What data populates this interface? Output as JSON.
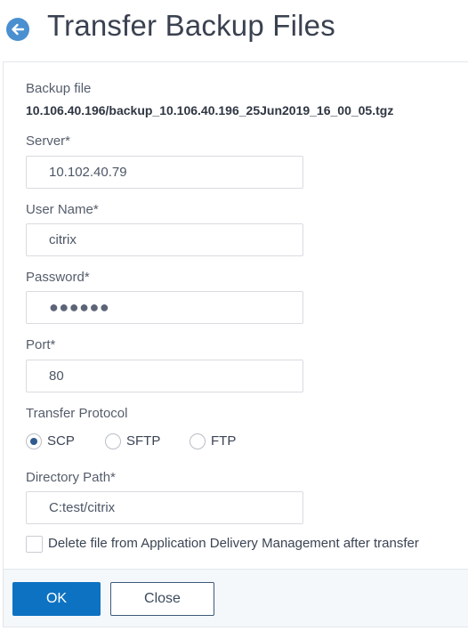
{
  "header": {
    "title": "Transfer Backup Files",
    "back_icon": "arrow-left-circle-icon"
  },
  "form": {
    "backup_file": {
      "label": "Backup file",
      "value": "10.106.40.196/backup_10.106.40.196_25Jun2019_16_00_05.tgz"
    },
    "server": {
      "label": "Server*",
      "value": "10.102.40.79"
    },
    "user_name": {
      "label": "User Name*",
      "value": "citrix"
    },
    "password": {
      "label": "Password*",
      "value": "●●●●●●"
    },
    "port": {
      "label": "Port*",
      "value": "80"
    },
    "transfer_protocol": {
      "label": "Transfer Protocol",
      "options": [
        {
          "label": "SCP",
          "selected": true
        },
        {
          "label": "SFTP",
          "selected": false
        },
        {
          "label": "FTP",
          "selected": false
        }
      ]
    },
    "directory_path": {
      "label": "Directory Path*",
      "value": "C:test/citrix"
    },
    "delete_after_transfer": {
      "label": "Delete file from Application Delivery Management after transfer",
      "checked": false
    }
  },
  "footer": {
    "ok_label": "OK",
    "close_label": "Close"
  },
  "colors": {
    "primary": "#0d72c2",
    "back_icon": "#4a90d0",
    "radio_selected": "#2f5b8f"
  }
}
